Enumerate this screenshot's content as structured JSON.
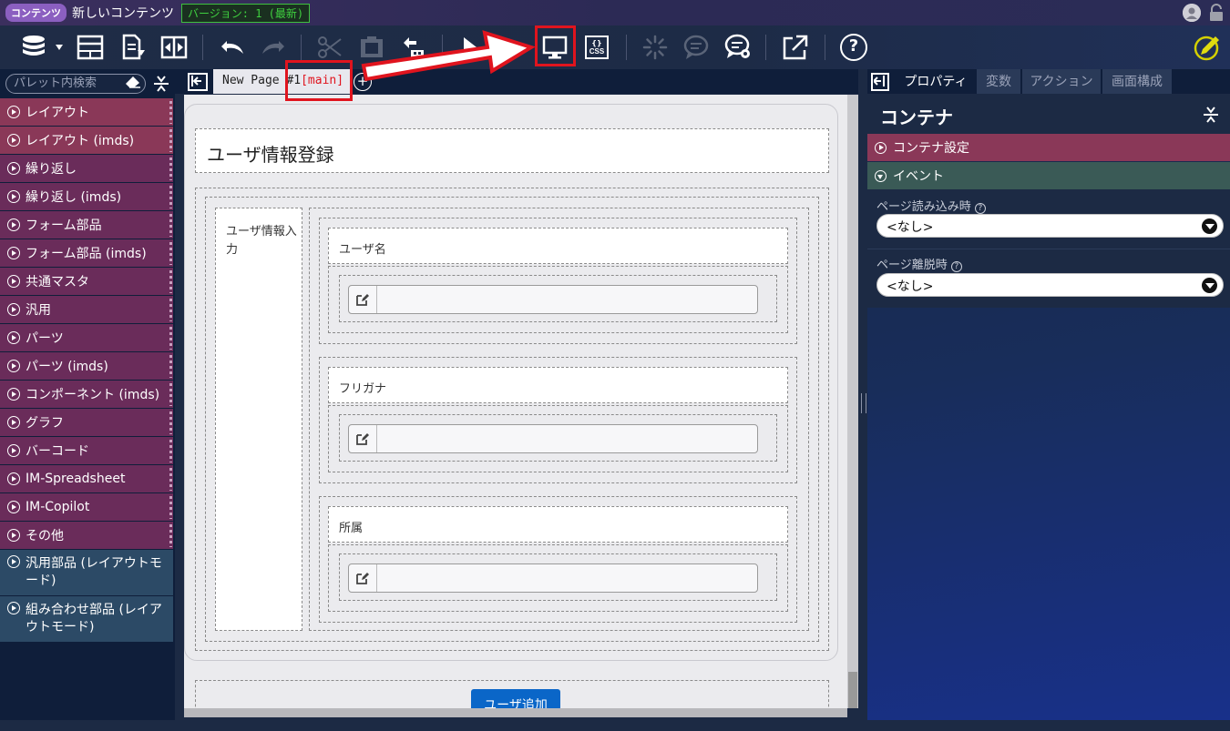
{
  "titlebar": {
    "badge": "コンテンツ",
    "title": "新しいコンテンツ",
    "version": "バージョン: 1 (最新)"
  },
  "toolbar": {
    "icons": [
      "database-menu-icon",
      "layout-icon",
      "export-icon",
      "resize-icon",
      "undo-icon",
      "redo-icon",
      "cut-icon",
      "paste-icon",
      "transfer-icon",
      "pointer-icon",
      "preview-icon",
      "css-icon",
      "loading-icon",
      "comment-icon",
      "comment-settings-icon",
      "open-external-icon",
      "help-icon",
      "edit-pen-icon"
    ],
    "css_label": "CSS",
    "css_braces": "{}",
    "help_label": "?"
  },
  "palette": {
    "search_placeholder": "パレット内検索",
    "categories": [
      {
        "label": "レイアウト",
        "style": "red"
      },
      {
        "label": "レイアウト (imds)",
        "style": "red"
      },
      {
        "label": "繰り返し",
        "style": "purple"
      },
      {
        "label": "繰り返し (imds)",
        "style": "purple"
      },
      {
        "label": "フォーム部品",
        "style": "purple"
      },
      {
        "label": "フォーム部品 (imds)",
        "style": "purple"
      },
      {
        "label": "共通マスタ",
        "style": "purple"
      },
      {
        "label": "汎用",
        "style": "purple"
      },
      {
        "label": "パーツ",
        "style": "purple"
      },
      {
        "label": "パーツ (imds)",
        "style": "purple"
      },
      {
        "label": "コンポーネント (imds)",
        "style": "purple"
      },
      {
        "label": "グラフ",
        "style": "purple"
      },
      {
        "label": "バーコード",
        "style": "purple"
      },
      {
        "label": "IM-Spreadsheet",
        "style": "purple"
      },
      {
        "label": "IM-Copilot",
        "style": "purple"
      },
      {
        "label": "その他",
        "style": "purple"
      },
      {
        "label": "汎用部品 (レイアウトモード)",
        "style": "blue"
      },
      {
        "label": "組み合わせ部品 (レイアウトモード)",
        "style": "blue"
      }
    ]
  },
  "editor": {
    "tab_name": "New Page #1",
    "tab_suffix": "[main]",
    "add_label": "+",
    "form_title": "ユーザ情報登録",
    "section_label": "ユーザ情報入力",
    "fields": [
      {
        "label": "ユーザ名",
        "value": ""
      },
      {
        "label": "フリガナ",
        "value": ""
      },
      {
        "label": "所属",
        "value": ""
      }
    ],
    "add_button": "ユーザ追加"
  },
  "properties": {
    "tabs": [
      "プロパティ",
      "変数",
      "アクション",
      "画面構成"
    ],
    "title": "コンテナ",
    "sections": {
      "container_settings": "コンテナ設定",
      "event": "イベント"
    },
    "events": [
      {
        "label": "ページ読み込み時",
        "value": "<なし>"
      },
      {
        "label": "ページ離脱時",
        "value": "<なし>"
      }
    ]
  },
  "colors": {
    "highlight": "#e0141e",
    "primary_button": "#0a66c8",
    "category_red": "#8a3858",
    "category_purple": "#6a2c5a",
    "category_blue": "#2c4a66"
  }
}
